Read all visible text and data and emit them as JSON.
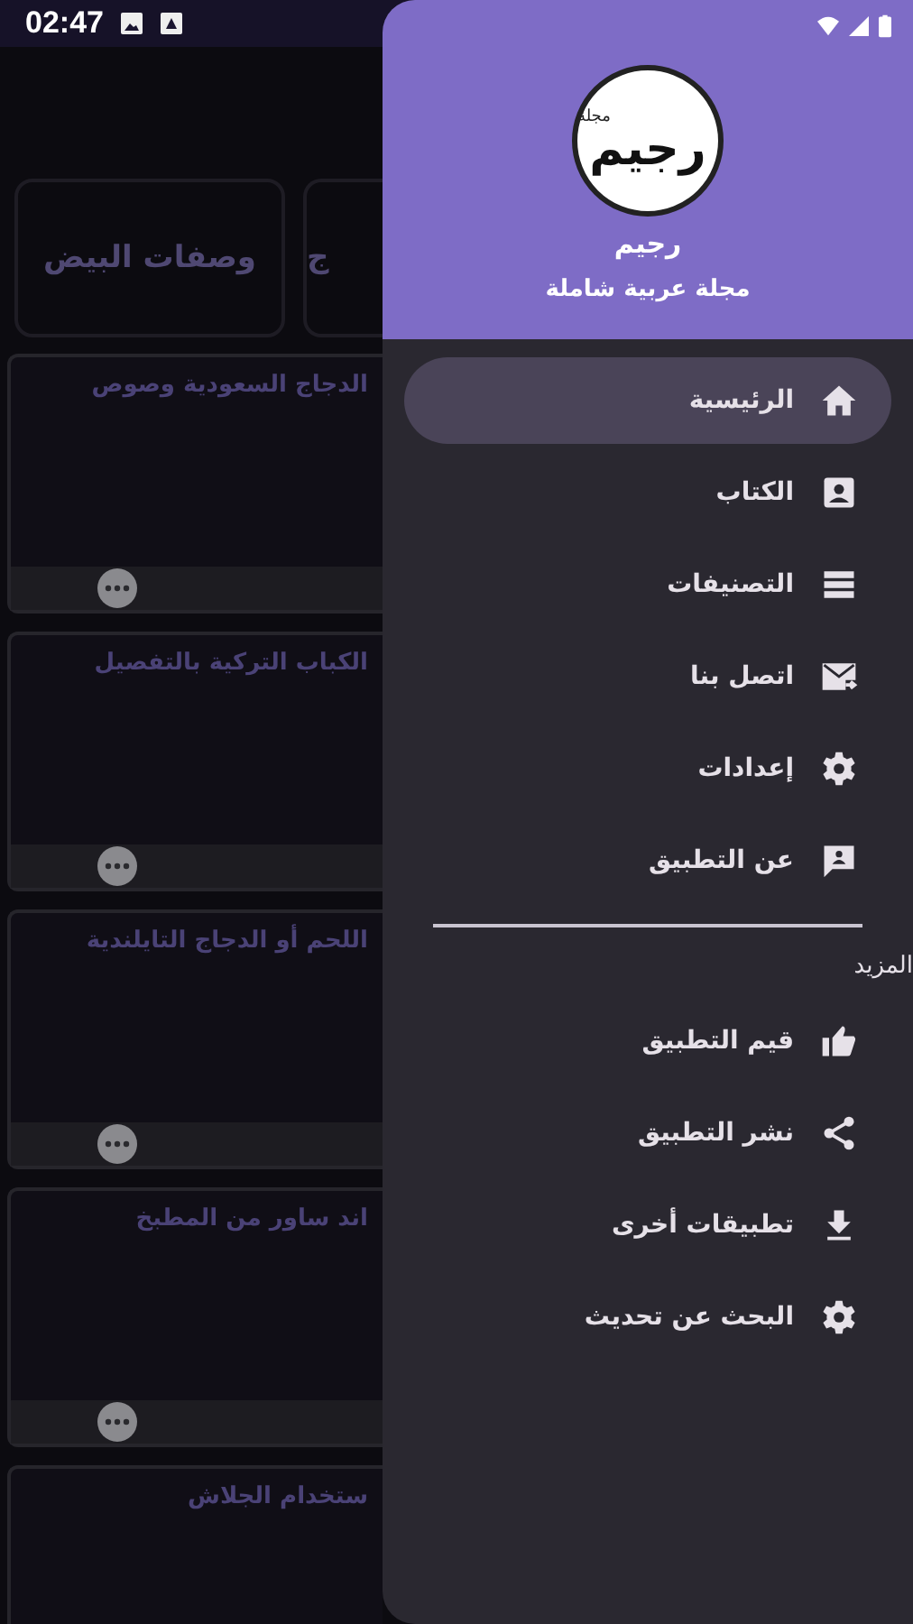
{
  "status_bar": {
    "time": "02:47"
  },
  "categories": [
    {
      "title": "ج"
    },
    {
      "title": "وصفات البيض"
    }
  ],
  "recipes": [
    {
      "title": "الدجاج السعودية وصوص"
    },
    {
      "title": "الكباب التركية بالتفصيل"
    },
    {
      "title": "اللحم أو الدجاج التايلندية"
    },
    {
      "title": "اند ساور من المطبخ"
    },
    {
      "title": "ستخدام الجلاش"
    }
  ],
  "drawer": {
    "logo": {
      "tag": "مجلة",
      "text": "رجيم"
    },
    "title": "رجيم",
    "subtitle": "مجلة عربية شاملة",
    "menu": [
      {
        "label": "الرئيسية",
        "kind": "home",
        "selected": true
      },
      {
        "label": "الكتاب",
        "kind": "person",
        "selected": false
      },
      {
        "label": "التصنيفات",
        "kind": "list",
        "selected": false
      },
      {
        "label": "اتصل بنا",
        "kind": "mail",
        "selected": false
      },
      {
        "label": "إعدادات",
        "kind": "gear",
        "selected": false
      },
      {
        "label": "عن التطبيق",
        "kind": "feedback",
        "selected": false
      }
    ],
    "section_label": "المزيد",
    "more": [
      {
        "label": "قيم التطبيق",
        "kind": "thumb",
        "selected": false
      },
      {
        "label": "نشر التطبيق",
        "kind": "share",
        "selected": false
      },
      {
        "label": "تطبيقات أخرى",
        "kind": "download",
        "selected": false
      },
      {
        "label": "البحث عن تحديث",
        "kind": "gear",
        "selected": false
      }
    ]
  }
}
